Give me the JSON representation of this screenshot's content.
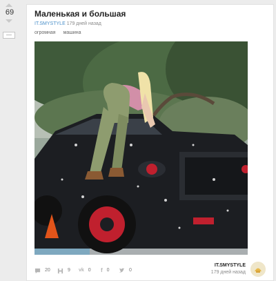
{
  "vote": {
    "score": "69",
    "minus_label": "—"
  },
  "post": {
    "title": "Маленькая и большая",
    "author": "IT.SMYSTYLE",
    "time_ago": "179 дней назад",
    "tags": [
      "огромная",
      "машина"
    ]
  },
  "stats": {
    "comments": "20",
    "saves": "9",
    "vk_shares": "0",
    "fb_shares": "0",
    "twitter_shares": "0"
  },
  "footer": {
    "author": "IT.SMYSTYLE",
    "time_ago": "179 дней назад"
  },
  "icons": {
    "upvote": "arrow-up-icon",
    "downvote": "arrow-down-icon",
    "comments": "comment-icon",
    "saves": "floppy-disk-icon",
    "vk": "vk-icon",
    "facebook": "facebook-icon",
    "twitter": "twitter-icon"
  },
  "colors": {
    "author_link": "#4a90c9",
    "icon_gray": "#b5b5b5",
    "truck": "#1c1e22",
    "wheel_accent": "#c0202e"
  }
}
